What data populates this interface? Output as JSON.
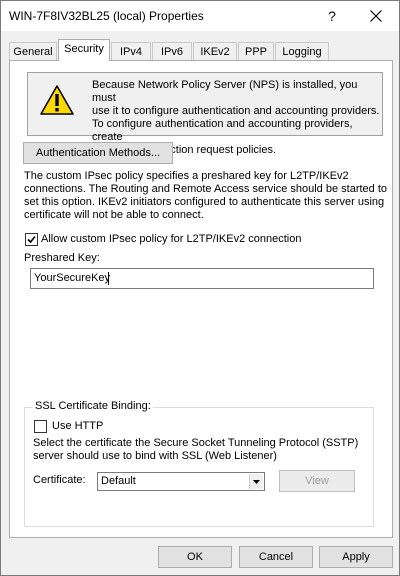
{
  "window": {
    "title": "WIN-7F8IV32BL25 (local) Properties",
    "help_glyph": "?"
  },
  "tabs": [
    {
      "label": "General"
    },
    {
      "label": "Security"
    },
    {
      "label": "IPv4"
    },
    {
      "label": "IPv6"
    },
    {
      "label": "IKEv2"
    },
    {
      "label": "PPP"
    },
    {
      "label": "Logging"
    }
  ],
  "active_tab": "Security",
  "nps_notice": {
    "lines": [
      "Because Network Policy Server (NPS) is installed, you must",
      "use it to configure authentication and accounting providers.",
      "To configure authentication and accounting providers, create",
      "or modify connection request policies."
    ]
  },
  "auth_methods_button": {
    "label": "Authentication Methods..."
  },
  "ipsec_description": {
    "lines": [
      "The custom IPsec policy specifies a preshared key for L2TP/IKEv2",
      "connections. The Routing and Remote Access service should be started to",
      "set this option. IKEv2 initiators configured to authenticate this server using",
      "certificate will not be able to connect."
    ]
  },
  "allow_custom_ipsec": {
    "label": "Allow custom IPsec policy for L2TP/IKEv2 connection",
    "checked": true
  },
  "preshared_key": {
    "label": "Preshared Key:",
    "value": "YourSecureKey"
  },
  "ssl_binding": {
    "group_label": "SSL Certificate Binding:",
    "use_http": {
      "label": "Use HTTP",
      "checked": false
    },
    "description_lines": [
      "Select the certificate the Secure Socket Tunneling Protocol (SSTP)",
      "server should use to bind with SSL (Web Listener)"
    ],
    "certificate_label": "Certificate:",
    "certificate_value": "Default",
    "view_button": "View"
  },
  "footer": {
    "ok": "OK",
    "cancel": "Cancel",
    "apply": "Apply"
  }
}
